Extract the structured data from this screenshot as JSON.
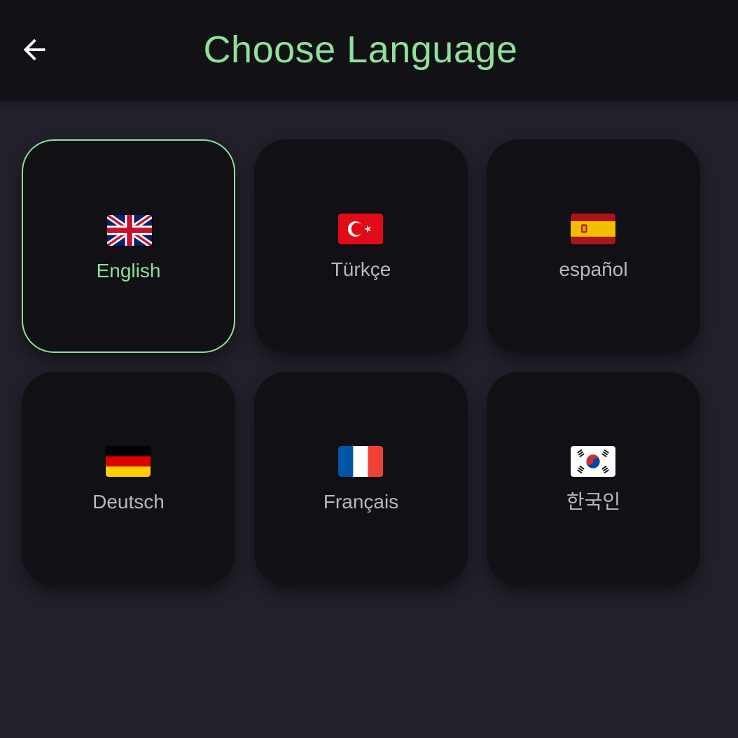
{
  "header": {
    "title": "Choose Language",
    "back_icon": "arrow-left-icon"
  },
  "colors": {
    "accent": "#8fe19a",
    "background": "#22202b",
    "topbar": "#121116",
    "card": "#111015",
    "label": "#b9b7bf"
  },
  "languages": [
    {
      "label": "English",
      "flag_icon": "uk-flag-icon",
      "selected": true
    },
    {
      "label": "Türkçe",
      "flag_icon": "turkey-flag-icon",
      "selected": false
    },
    {
      "label": "español",
      "flag_icon": "spain-flag-icon",
      "selected": false
    },
    {
      "label": "Deutsch",
      "flag_icon": "germany-flag-icon",
      "selected": false
    },
    {
      "label": "Français",
      "flag_icon": "france-flag-icon",
      "selected": false
    },
    {
      "label": "한국인",
      "flag_icon": "south-korea-flag-icon",
      "selected": false
    }
  ]
}
